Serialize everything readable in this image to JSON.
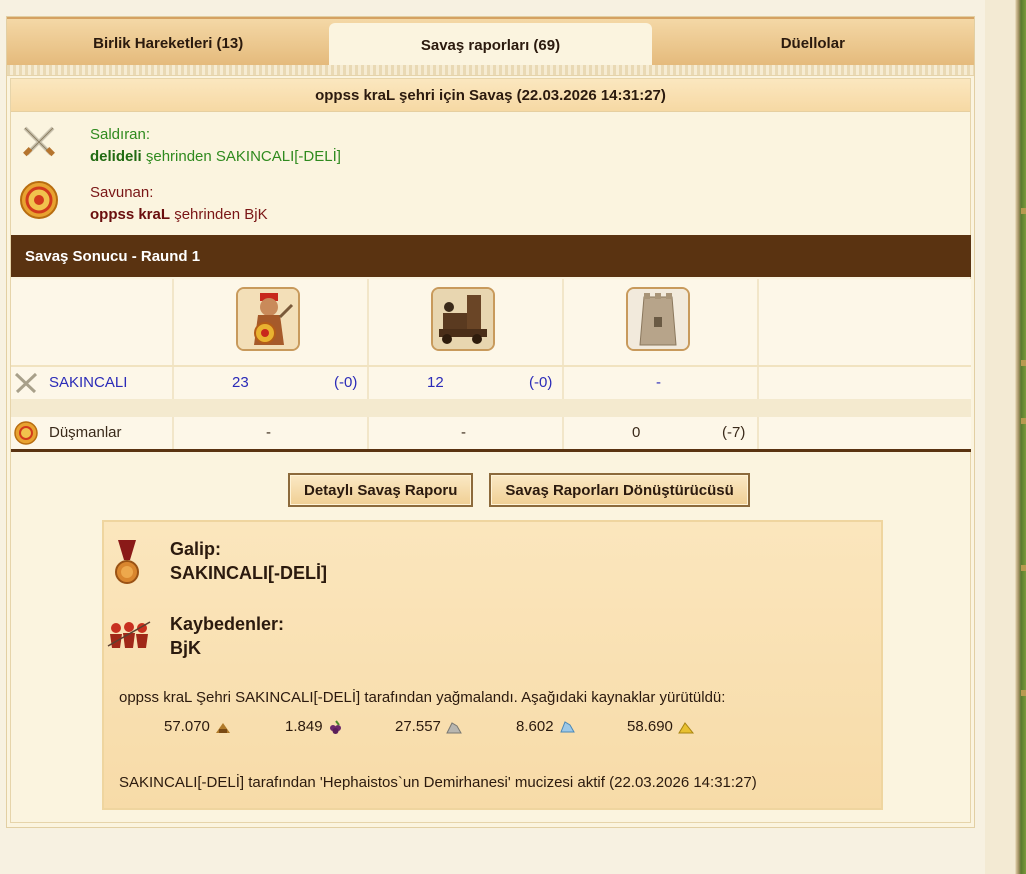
{
  "tabs": [
    {
      "label": "Birlik Hareketleri (13)",
      "active": false
    },
    {
      "label": "Savaş raporları (69)",
      "active": true
    },
    {
      "label": "Düellolar",
      "active": false
    }
  ],
  "report": {
    "title": "oppss kraL şehri için Savaş (22.03.2026 14:31:27)",
    "attacker": {
      "label": "Saldıran:",
      "city": "delideli",
      "rest": " şehrinden SAKINCALI[-DELİ]"
    },
    "defender": {
      "label": "Savunan:",
      "city": "oppss kraL",
      "rest": " şehrinden BjK"
    },
    "result_header": "Savaş Sonucu - Raund 1",
    "units": [
      "swordsman-icon",
      "siege-icon",
      "wall-icon"
    ],
    "rows": [
      {
        "name": "SAKINCALI",
        "cells": [
          {
            "count": "23",
            "loss": "(-0)"
          },
          {
            "count": "12",
            "loss": "(-0)"
          },
          {
            "count": "-",
            "loss": ""
          }
        ]
      },
      {
        "name": "Düşmanlar",
        "cells": [
          {
            "count": "-",
            "loss": ""
          },
          {
            "count": "-",
            "loss": ""
          },
          {
            "count": "0",
            "loss": "(-7)"
          }
        ]
      }
    ],
    "buttons": {
      "detail": "Detaylı Savaş Raporu",
      "converter": "Savaş Raporları Dönüştürücüsü"
    },
    "winner_label": "Galip:",
    "winner": "SAKINCALI[-DELİ]",
    "losers_label": "Kaybedenler:",
    "losers": "BjK",
    "plunder_text": "oppss kraL Şehri SAKINCALI[-DELİ] tarafından yağmalandı. Aşağıdaki kaynaklar yürütüldü:",
    "resources": [
      {
        "value": "57.070",
        "icon": "wood-icon"
      },
      {
        "value": "1.849",
        "icon": "grapes-icon"
      },
      {
        "value": "27.557",
        "icon": "marble-icon"
      },
      {
        "value": "8.602",
        "icon": "crystal-icon"
      },
      {
        "value": "58.690",
        "icon": "sulfur-icon"
      }
    ],
    "wonder_text": "SAKINCALI[-DELİ] tarafından 'Hephaistos`un Demirhanesi' mucizesi aktif (22.03.2026 14:31:27)"
  },
  "colors": {
    "header_brown": "#5a3311",
    "attacker_green": "#2f8a1e",
    "defender_red": "#7a1616",
    "unit_blue": "#2b2bb8"
  }
}
